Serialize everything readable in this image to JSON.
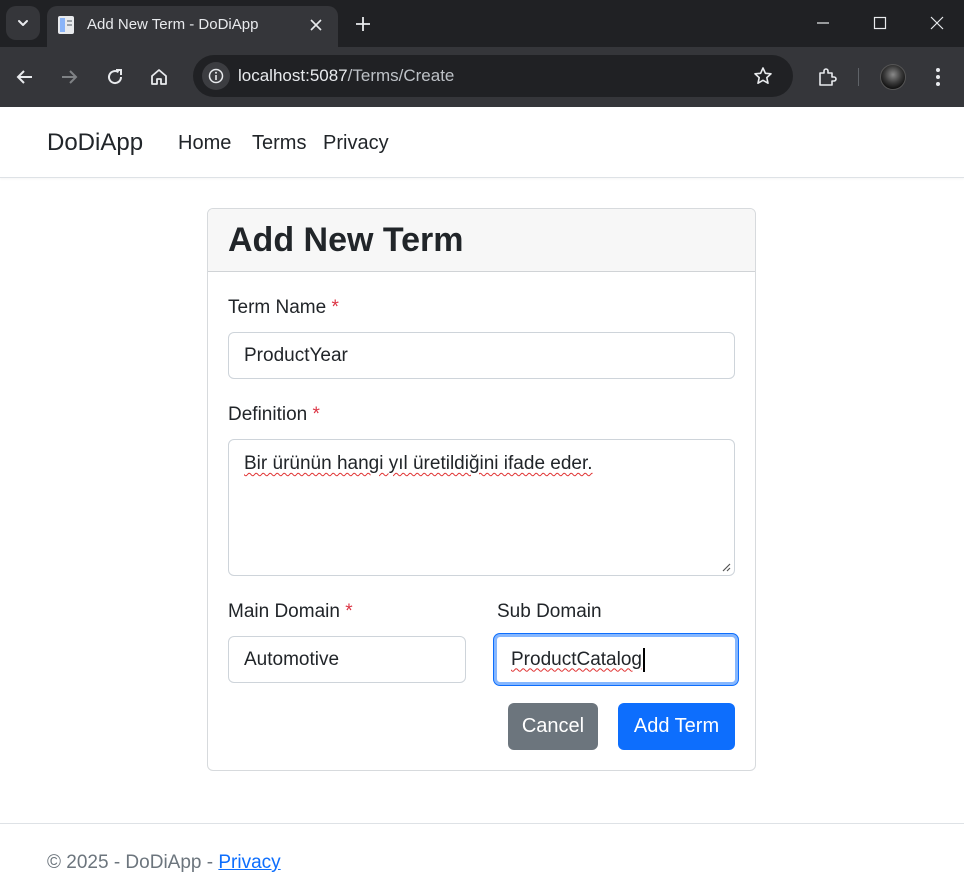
{
  "browser": {
    "tab_title": "Add New Term - DoDiApp",
    "url_host": "localhost:5087",
    "url_path": "/Terms/Create"
  },
  "navbar": {
    "brand": "DoDiApp",
    "links": [
      "Home",
      "Terms",
      "Privacy"
    ]
  },
  "form": {
    "title": "Add New Term",
    "required_marker": "*",
    "term_name": {
      "label": "Term Name",
      "value": "ProductYear"
    },
    "definition": {
      "label": "Definition",
      "value": "Bir ürünün hangi yıl üretildiğini ifade eder."
    },
    "main_domain": {
      "label": "Main Domain",
      "value": "Automotive"
    },
    "sub_domain": {
      "label": "Sub Domain",
      "value": "ProductCatalog"
    },
    "cancel_label": "Cancel",
    "submit_label": "Add Term"
  },
  "footer": {
    "text": "© 2025 - DoDiApp - ",
    "link": "Privacy"
  },
  "colors": {
    "primary": "#0d6efd",
    "secondary": "#6c757d",
    "required": "#dc3545",
    "focus_ring": "#86b7fe"
  }
}
